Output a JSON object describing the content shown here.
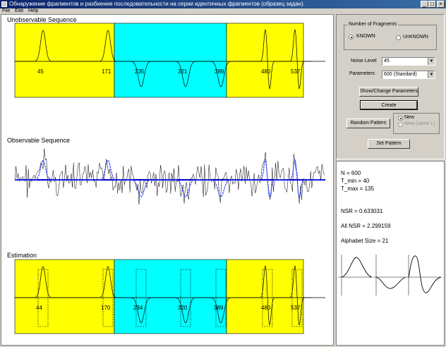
{
  "window": {
    "title": "Обнаружение фрагментов и разбиение последовательности на серии идентичных фрагментов (образец задан)."
  },
  "menu": [
    "File",
    "Edit",
    "Help"
  ],
  "plots": {
    "unobservable": {
      "title": "Unobservable Sequence",
      "bands": [
        {
          "from": 0,
          "to": 160,
          "color": "#ffff00"
        },
        {
          "from": 160,
          "to": 320,
          "color": "#00ffff"
        },
        {
          "from": 320,
          "to": 428,
          "color": "#ffff00"
        }
      ],
      "markers": [
        "45",
        "171",
        "235",
        "321",
        "389",
        "480",
        "537"
      ]
    },
    "observable": {
      "title": "Observable Sequence"
    },
    "estimation": {
      "title": "Estimation",
      "markers": [
        "44",
        "170",
        "234",
        "320",
        "389",
        "480",
        "537"
      ]
    }
  },
  "controls": {
    "fragments_group": "Number of Fragments",
    "known_label": "KNOWN",
    "unknown_label": "UnKNOWN",
    "noise_label": "Noise Level",
    "noise_value": "45",
    "params_label": "Parameters",
    "params_value": "600 (Standard)",
    "show_change": "Show/Change Parameters",
    "create": "Create",
    "random_pattern": "Random Pattern",
    "new_label": "New",
    "new_same_label": "New (same L)",
    "set_pattern": "Set Pattern"
  },
  "info": {
    "n": "N = 600",
    "tmin": "T_min = 40",
    "tmax": "T_max = 135",
    "nsr": "NSR = 0.633031",
    "all_nsr": "All NSR = 2.299159",
    "alphabet": "Alphabet Size = 21"
  },
  "colors": {
    "yellow": "#ffff00",
    "cyan": "#00ffff",
    "signal": "#0000cc"
  }
}
